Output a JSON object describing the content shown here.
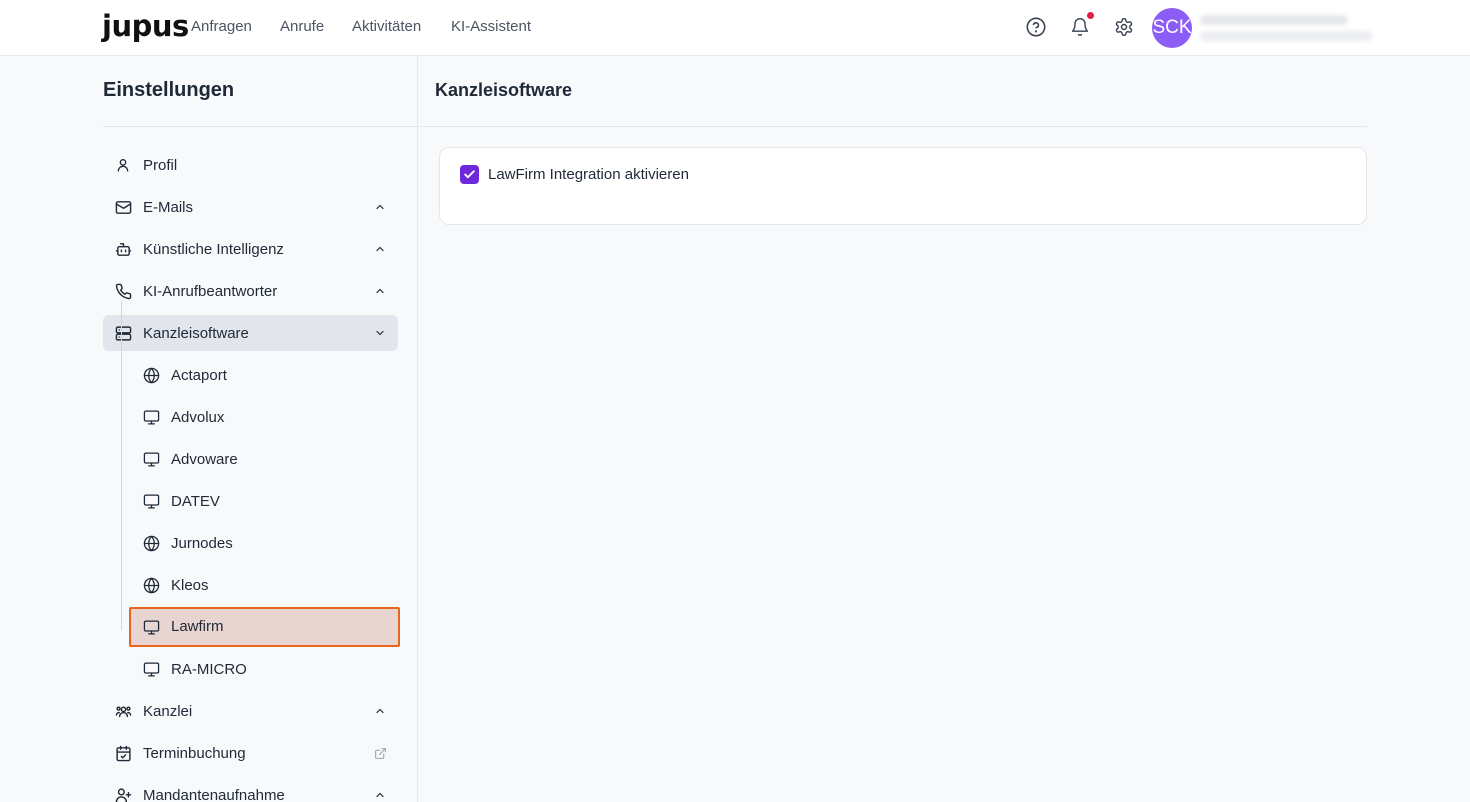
{
  "header": {
    "logo": "jupus",
    "nav": [
      "Anfragen",
      "Anrufe",
      "Aktivitäten",
      "KI-Assistent"
    ],
    "avatar_initials": "SCK",
    "notification_dot_color": "#e11d48"
  },
  "sidebar": {
    "title": "Einstellungen",
    "items": [
      {
        "label": "Profil",
        "icon": "user-icon"
      },
      {
        "label": "E-Mails",
        "icon": "mail-icon",
        "chevron": "up"
      },
      {
        "label": "Künstliche Intelligenz",
        "icon": "bot-icon",
        "chevron": "up"
      },
      {
        "label": "KI-Anrufbeantworter",
        "icon": "phone-icon",
        "chevron": "up"
      },
      {
        "label": "Kanzleisoftware",
        "icon": "server-icon",
        "chevron": "down",
        "active": true
      },
      {
        "label": "Kanzlei",
        "icon": "users-icon",
        "chevron": "up"
      },
      {
        "label": "Terminbuchung",
        "icon": "calendar-check-icon",
        "trailing": "external-link-icon"
      },
      {
        "label": "Mandantenaufnahme",
        "icon": "user-plus-icon",
        "chevron": "up"
      }
    ],
    "subitems": [
      {
        "label": "Actaport",
        "icon": "globe-icon"
      },
      {
        "label": "Advolux",
        "icon": "monitor-icon"
      },
      {
        "label": "Advoware",
        "icon": "monitor-icon"
      },
      {
        "label": "DATEV",
        "icon": "monitor-icon"
      },
      {
        "label": "Jurnodes",
        "icon": "globe-icon"
      },
      {
        "label": "Kleos",
        "icon": "globe-icon"
      },
      {
        "label": "Lawfirm",
        "icon": "monitor-icon",
        "selected": true
      },
      {
        "label": "RA-MICRO",
        "icon": "monitor-icon"
      }
    ]
  },
  "main": {
    "title": "Kanzleisoftware",
    "checkbox_label": "LawFirm Integration aktivieren",
    "checkbox_checked": true,
    "accent_color": "#6d28d9"
  }
}
